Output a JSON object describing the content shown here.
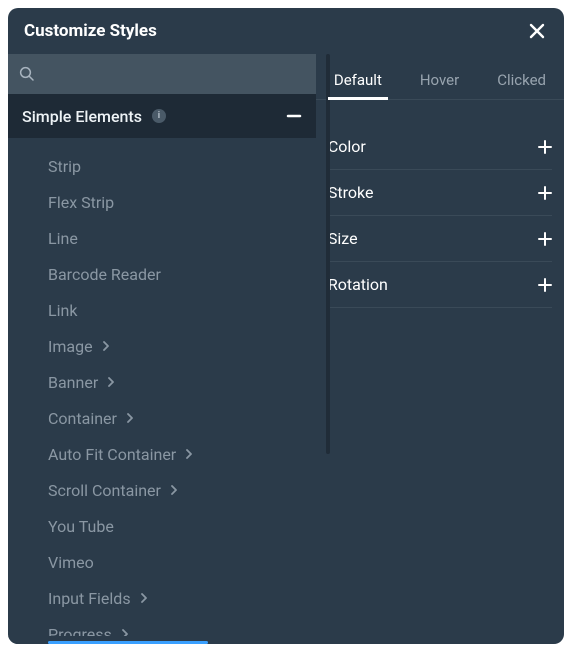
{
  "header": {
    "title": "Customize Styles"
  },
  "sidebar": {
    "category": {
      "title": "Simple Elements",
      "info": "i"
    },
    "items": [
      {
        "label": "Strip",
        "chevron": false
      },
      {
        "label": "Flex Strip",
        "chevron": false
      },
      {
        "label": "Line",
        "chevron": false
      },
      {
        "label": "Barcode Reader",
        "chevron": false
      },
      {
        "label": "Link",
        "chevron": false
      },
      {
        "label": "Image",
        "chevron": true
      },
      {
        "label": "Banner",
        "chevron": true
      },
      {
        "label": "Container",
        "chevron": true
      },
      {
        "label": "Auto Fit Container",
        "chevron": true
      },
      {
        "label": "Scroll Container",
        "chevron": true
      },
      {
        "label": "You Tube",
        "chevron": false
      },
      {
        "label": "Vimeo",
        "chevron": false
      },
      {
        "label": "Input Fields",
        "chevron": true
      },
      {
        "label": "Progress",
        "chevron": true
      }
    ]
  },
  "tabs": [
    {
      "label": "Default",
      "active": true
    },
    {
      "label": "Hover",
      "active": false
    },
    {
      "label": "Clicked",
      "active": false
    }
  ],
  "properties": [
    {
      "label": "Color"
    },
    {
      "label": "Stroke"
    },
    {
      "label": "Size"
    },
    {
      "label": "Rotation"
    }
  ]
}
